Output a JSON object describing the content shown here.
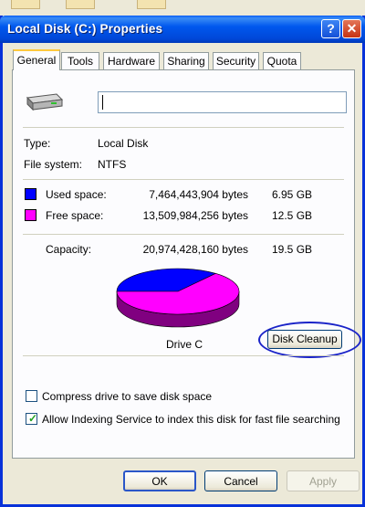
{
  "window": {
    "title": "Local Disk (C:) Properties",
    "help_label": "?",
    "close_label": "✕"
  },
  "tabs": [
    {
      "label": "General",
      "active": true
    },
    {
      "label": "Tools",
      "active": false
    },
    {
      "label": "Hardware",
      "active": false
    },
    {
      "label": "Sharing",
      "active": false
    },
    {
      "label": "Security",
      "active": false
    },
    {
      "label": "Quota",
      "active": false
    }
  ],
  "volume": {
    "label_value": "",
    "icon": "hard-drive-icon"
  },
  "info": {
    "type_label": "Type:",
    "type_value": "Local Disk",
    "fs_label": "File system:",
    "fs_value": "NTFS"
  },
  "space": {
    "used_label": "Used space:",
    "used_bytes": "7,464,443,904 bytes",
    "used_gb": "6.95 GB",
    "used_color": "#0000ff",
    "free_label": "Free space:",
    "free_bytes": "13,509,984,256 bytes",
    "free_gb": "12.5 GB",
    "free_color": "#ff00ff",
    "capacity_label": "Capacity:",
    "capacity_bytes": "20,974,428,160 bytes",
    "capacity_gb": "19.5 GB"
  },
  "drive_label": "Drive C",
  "cleanup_button": "Disk Cleanup",
  "options": {
    "compress_label": "Compress drive to save disk space",
    "compress_checked": false,
    "index_label": "Allow Indexing Service to index this disk for fast file searching",
    "index_checked": true
  },
  "buttons": {
    "ok": "OK",
    "cancel": "Cancel",
    "apply": "Apply"
  },
  "chart_data": {
    "type": "pie",
    "categories": [
      "Used space",
      "Free space"
    ],
    "values": [
      7464443904,
      13509984256
    ]
  }
}
